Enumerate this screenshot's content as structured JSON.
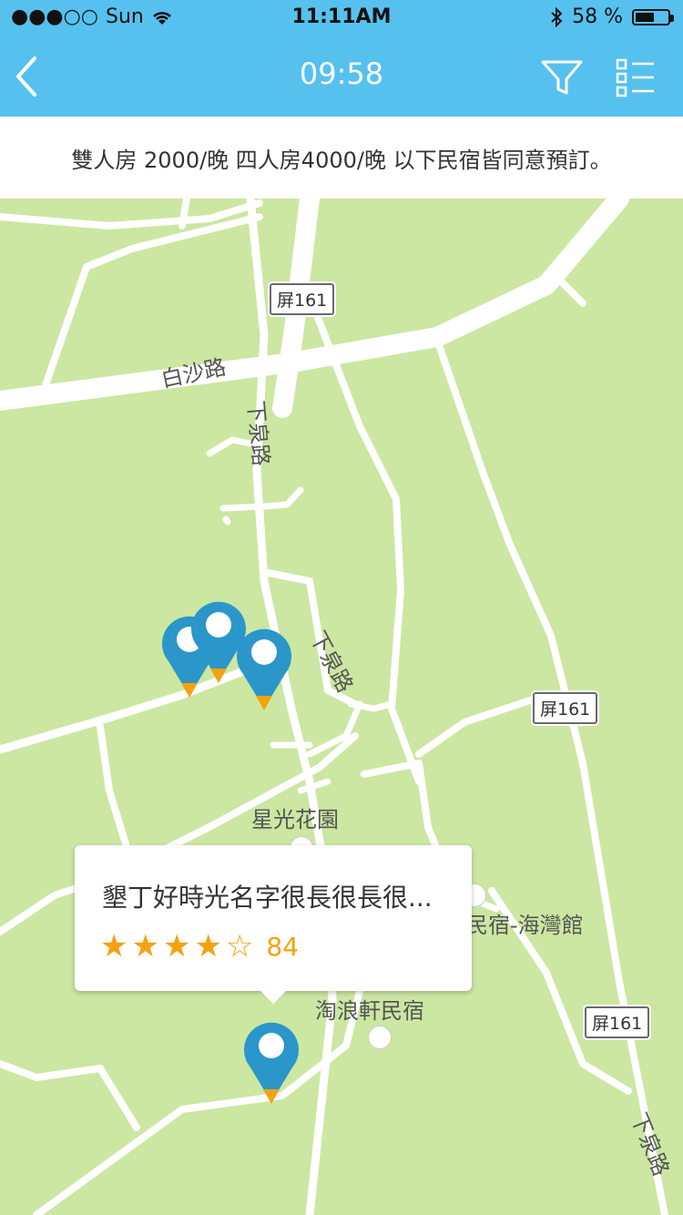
{
  "status_bar": {
    "signal": "●●●○○",
    "carrier": "Sun",
    "time": "11:11AM",
    "battery_percent": "58 %",
    "battery_level": 0.58
  },
  "nav": {
    "title": "09:58",
    "back_icon": "chevron-left-icon",
    "filter_icon": "filter-icon",
    "list_icon": "list-icon"
  },
  "notice": {
    "text": "雙人房 2000/晚 四人房4000/晚 以下民宿皆同意預訂。"
  },
  "map": {
    "labels": {
      "road_baisha": "白沙路",
      "road_xiaquan_1": "下泉路",
      "road_xiaquan_2": "下泉路",
      "road_xiaquan_3": "下泉路",
      "poi_xingguang": "星光花園",
      "poi_haiwan": "民宿-海灣館",
      "poi_taolang": "淘浪軒民宿"
    },
    "badges": {
      "b1": "屏161",
      "b2": "屏161",
      "b3": "屏161"
    }
  },
  "callout": {
    "title": "墾丁好時光名字很長很長很...",
    "rating": 4,
    "max_rating": 5,
    "reviews": "84"
  },
  "colors": {
    "header": "#56c1ef",
    "map_bg": "#cbe7a2",
    "pin": "#2b96c9",
    "pin_tip": "#f4a20f",
    "star": "#f4a20f"
  }
}
